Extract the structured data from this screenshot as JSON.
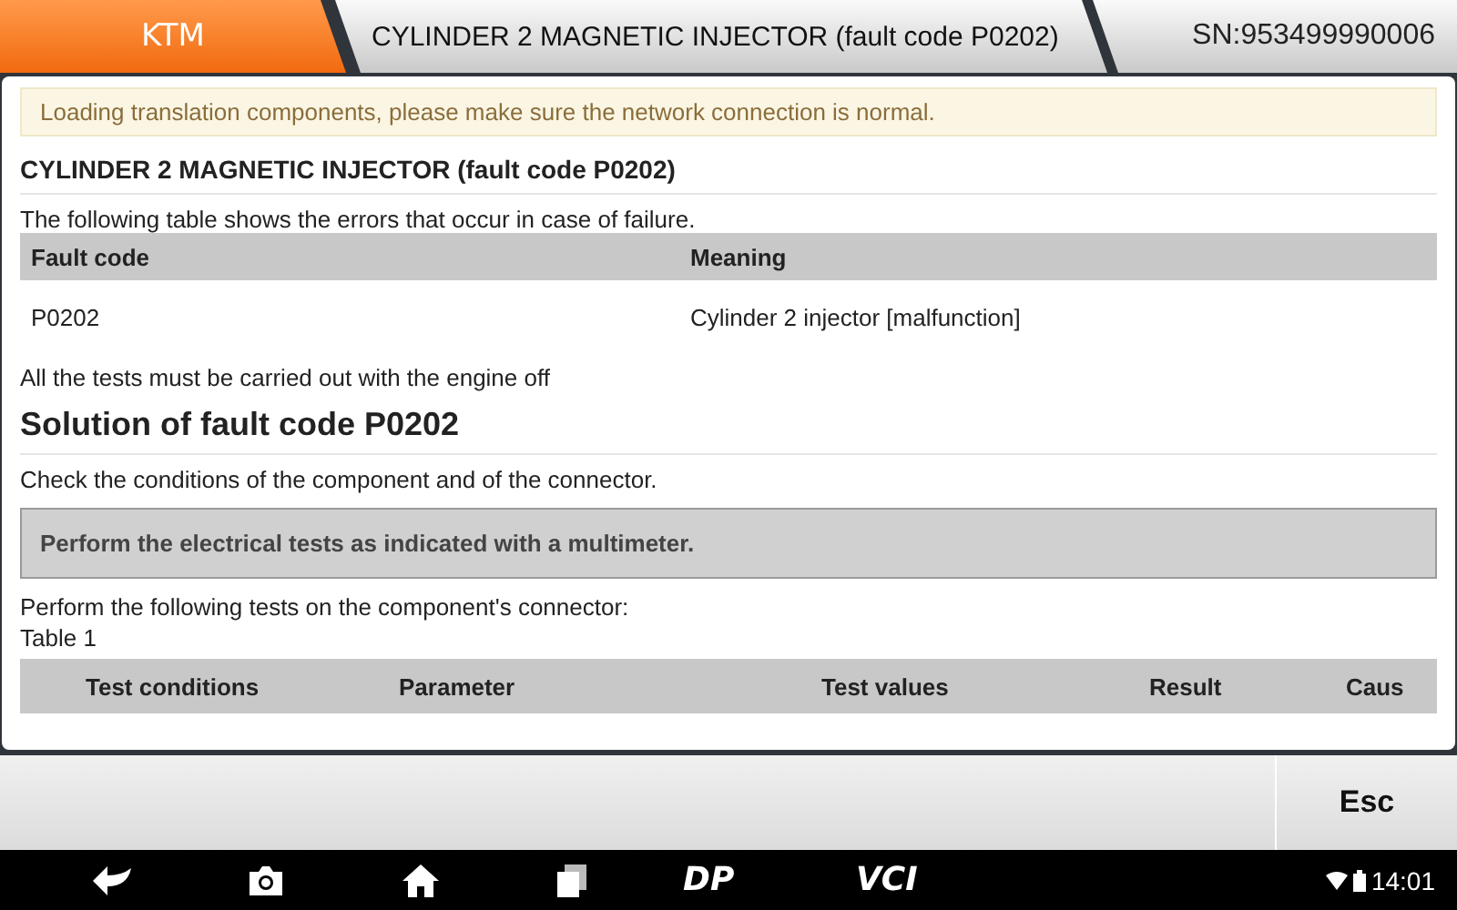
{
  "header": {
    "brand_tab": "KTM",
    "title_tab": "CYLINDER 2 MAGNETIC INJECTOR (fault code P0202)",
    "serial": "SN:953499990006"
  },
  "notice": "Loading translation components, please make sure the network connection is normal.",
  "content": {
    "title": "CYLINDER 2 MAGNETIC INJECTOR (fault code P0202)",
    "intro": "The following table shows the errors that occur in case of failure.",
    "fault_table": {
      "columns": [
        "Fault code",
        "Meaning"
      ],
      "rows": [
        [
          "P0202",
          "Cylinder 2 injector [malfunction]"
        ]
      ]
    },
    "note": "All the tests must be carried out with the engine off",
    "solution_heading": "Solution of fault code P0202",
    "check_text": "Check the conditions of the component and of the connector.",
    "callout": "Perform the electrical tests as indicated with a multimeter.",
    "tests_intro": "Perform the following tests on the component's connector:",
    "table_label": "Table 1",
    "test_table": {
      "columns": [
        "Test conditions",
        "Parameter",
        "Test values",
        "Result",
        "Caus"
      ]
    }
  },
  "bottom_bar": {
    "button": "Esc"
  },
  "nav_bar": {
    "dp_label": "DP",
    "vci_label": "VCI",
    "time": "14:01"
  }
}
